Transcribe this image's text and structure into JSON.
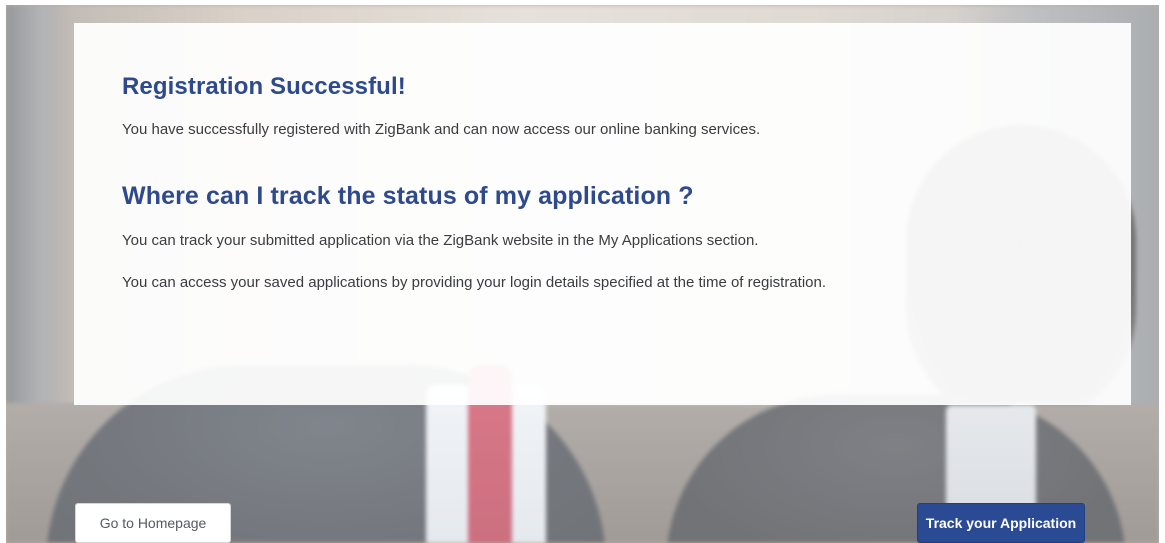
{
  "content": {
    "heading_success": "Registration Successful!",
    "success_text": "You have successfully registered with ZigBank and can now access our online banking services.",
    "heading_track": "Where can I track the status of my application ?",
    "track_text": "You can track your submitted application via the ZigBank website in the My Applications section.",
    "access_text": "You can access your saved applications by providing your login details specified at the time of registration."
  },
  "actions": {
    "homepage_label": "Go to Homepage",
    "track_label": "Track your Application"
  },
  "colors": {
    "heading": "#2e4a8d",
    "primary_button": "#2b4a94",
    "body_text": "#3a3c40"
  }
}
